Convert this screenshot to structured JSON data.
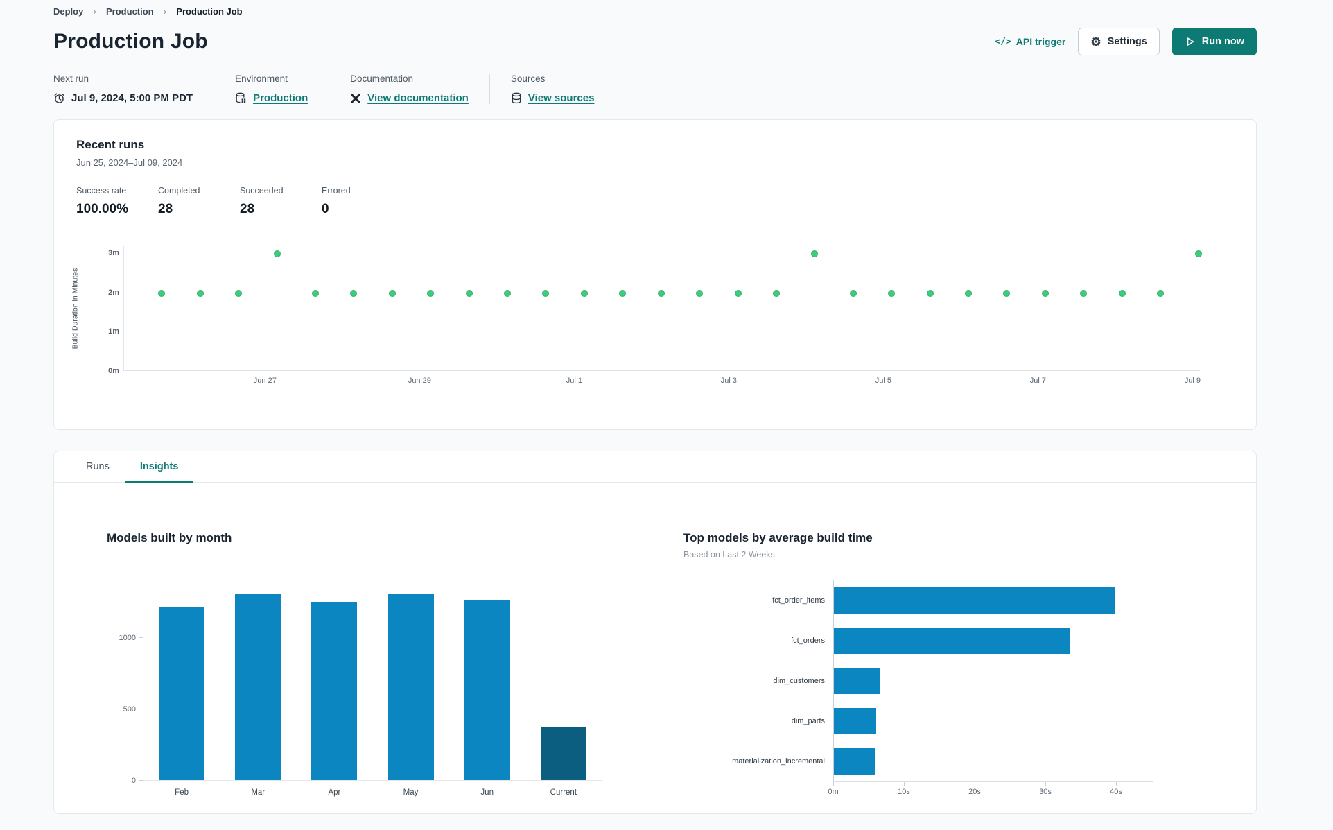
{
  "theme": {
    "accent_teal": "#0e7a74",
    "bar_blue": "#0c86c0",
    "bar_dark_blue": "#0b5e80",
    "dot_green": "#41c97d"
  },
  "breadcrumb": {
    "separator": "›",
    "items": [
      "Deploy",
      "Production",
      "Production Job"
    ]
  },
  "header": {
    "title": "Production Job",
    "api_trigger_label": "API trigger",
    "settings_label": "Settings",
    "run_now_label": "Run now"
  },
  "job_meta": {
    "next_run": {
      "label": "Next run",
      "value": "Jul 9, 2024, 5:00 PM PDT"
    },
    "environment": {
      "label": "Environment",
      "value": "Production"
    },
    "documentation": {
      "label": "Documentation",
      "value": "View documentation"
    },
    "sources": {
      "label": "Sources",
      "value": "View sources"
    }
  },
  "recent_runs": {
    "title": "Recent runs",
    "date_range": "Jun 25, 2024–Jul 09, 2024",
    "stats": [
      {
        "label": "Success rate",
        "value": "100.00%"
      },
      {
        "label": "Completed",
        "value": "28"
      },
      {
        "label": "Succeeded",
        "value": "28"
      },
      {
        "label": "Errored",
        "value": "0"
      }
    ]
  },
  "tabs": [
    {
      "label": "Runs",
      "active": false
    },
    {
      "label": "Insights",
      "active": true
    }
  ],
  "chart_data": [
    {
      "id": "build-duration-scatter",
      "type": "scatter",
      "ylabel": "Build Duration in Minutes",
      "yticks": [
        {
          "label": "0m",
          "value": 0
        },
        {
          "label": "1m",
          "value": 1
        },
        {
          "label": "2m",
          "value": 2
        },
        {
          "label": "3m",
          "value": 3
        }
      ],
      "ylim": [
        0,
        3.2
      ],
      "xticks": [
        "Jun 27",
        "Jun 29",
        "Jul 1",
        "Jul 3",
        "Jul 5",
        "Jul 7",
        "Jul 9"
      ],
      "point_color": "#41c97d",
      "values_minutes": [
        1.97,
        1.97,
        1.97,
        2.97,
        1.97,
        1.97,
        1.97,
        1.97,
        1.97,
        1.97,
        1.97,
        1.97,
        1.97,
        1.97,
        1.97,
        1.97,
        1.97,
        2.97,
        1.97,
        1.97,
        1.97,
        1.97,
        1.97,
        1.97,
        1.97,
        1.97,
        1.97,
        2.97
      ]
    },
    {
      "id": "models-built-by-month",
      "type": "bar",
      "title": "Models built by month",
      "categories": [
        "Feb",
        "Mar",
        "Apr",
        "May",
        "Jun",
        "Current"
      ],
      "values": [
        1210,
        1300,
        1250,
        1300,
        1255,
        375
      ],
      "yticks": [
        {
          "label": "0",
          "value": 0
        },
        {
          "label": "500",
          "value": 500
        },
        {
          "label": "1000",
          "value": 1000
        }
      ],
      "ylim": [
        0,
        1400
      ],
      "grid": false,
      "bar_colors": [
        "#0c86c0",
        "#0c86c0",
        "#0c86c0",
        "#0c86c0",
        "#0c86c0",
        "#0b5e80"
      ]
    },
    {
      "id": "top-models-by-build-time",
      "type": "bar",
      "orientation": "horizontal",
      "title": "Top models by average build time",
      "subtitle": "Based on Last 2 Weeks",
      "categories": [
        "fct_order_items",
        "fct_orders",
        "dim_customers",
        "dim_parts",
        "materialization_incremental"
      ],
      "values_seconds": [
        39.8,
        33.4,
        6.5,
        6.0,
        5.9
      ],
      "xticks": [
        {
          "label": "0m",
          "value": 0
        },
        {
          "label": "10s",
          "value": 10
        },
        {
          "label": "20s",
          "value": 20
        },
        {
          "label": "30s",
          "value": 30
        },
        {
          "label": "40s",
          "value": 40
        }
      ],
      "xlim": [
        0,
        45
      ],
      "bar_color": "#0c86c0"
    }
  ]
}
